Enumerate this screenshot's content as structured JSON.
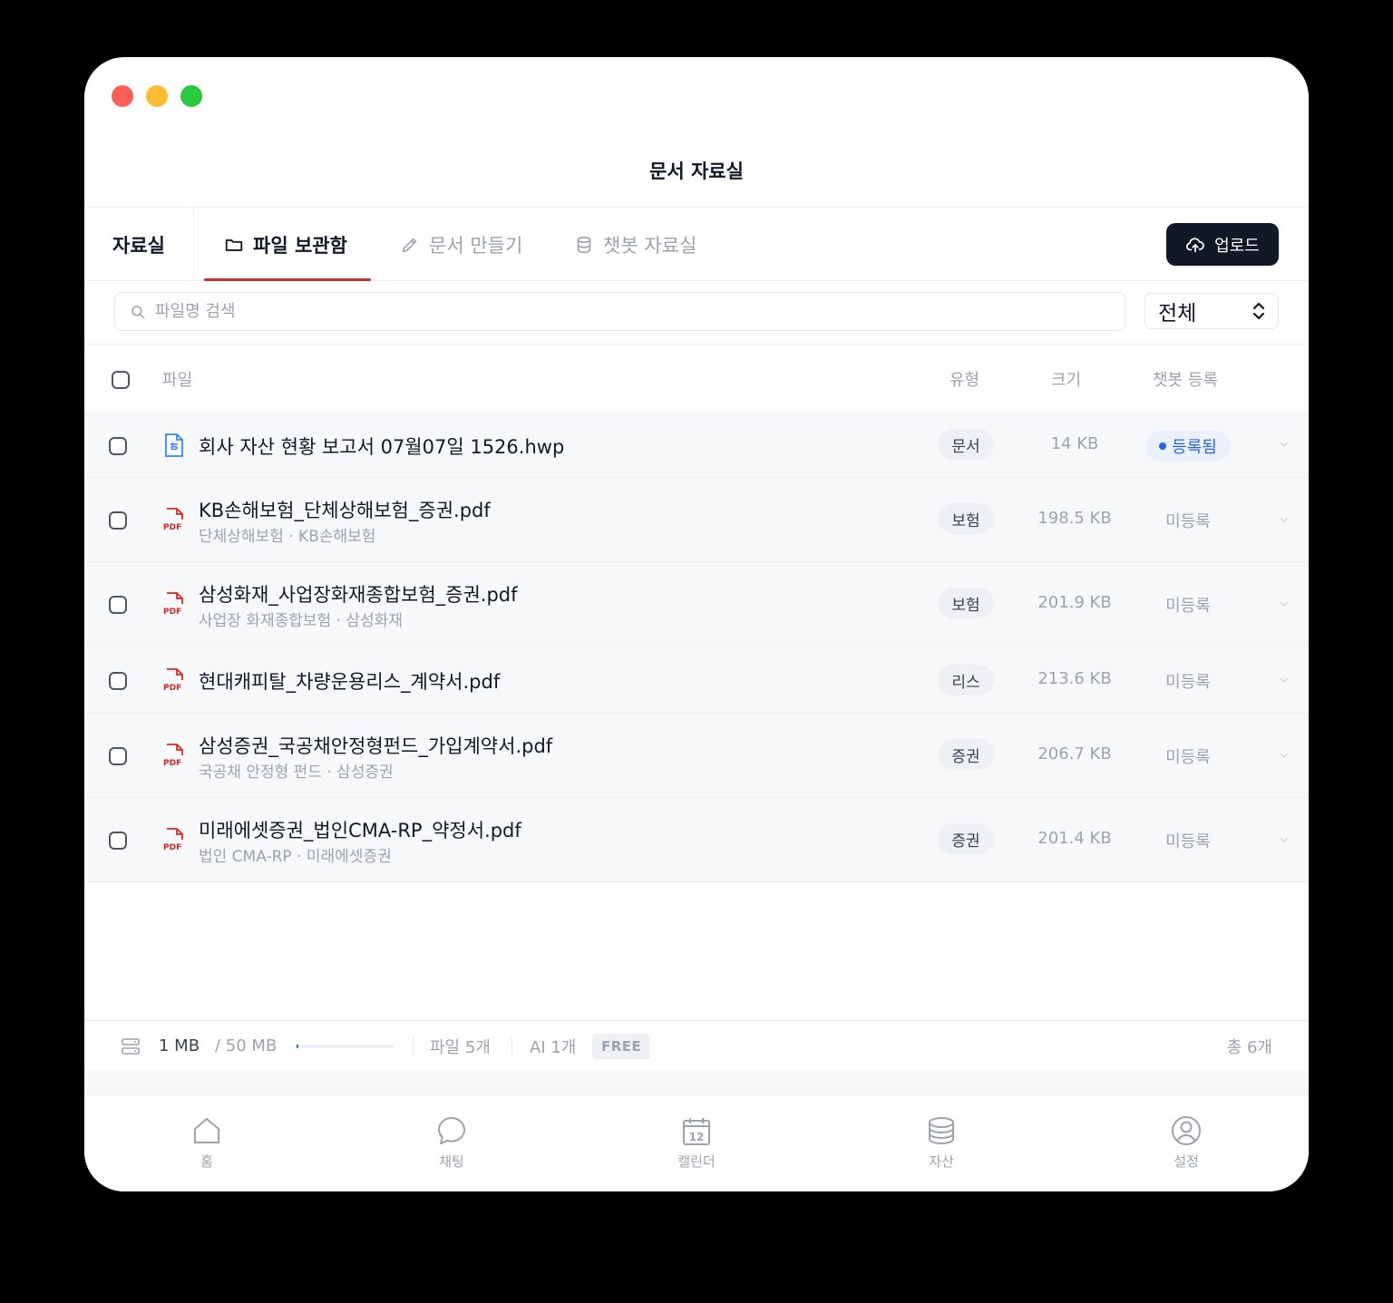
{
  "window": {
    "title": "문서 자료실"
  },
  "tabs": {
    "section_label": "자료실",
    "items": [
      {
        "label": "파일 보관함",
        "icon": "folder-icon",
        "active": true
      },
      {
        "label": "문서 만들기",
        "icon": "pencil-icon",
        "active": false
      },
      {
        "label": "챗봇 자료실",
        "icon": "database-icon",
        "active": false
      }
    ],
    "upload_label": "업로드"
  },
  "search": {
    "placeholder": "파일명 검색",
    "filter_value": "전체"
  },
  "table": {
    "headers": {
      "file": "파일",
      "type": "유형",
      "size": "크기",
      "chatbot": "챗봇 등록"
    },
    "rows": [
      {
        "name": "회사 자산 현황 보고서 07월07일 1526.hwp",
        "sub": "",
        "icon": "hwp-doc-icon",
        "type": "문서",
        "size": "14 KB",
        "status": "등록됨",
        "registered": true
      },
      {
        "name": "KB손해보험_단체상해보험_증권.pdf",
        "sub": "단체상해보험 · KB손해보험",
        "icon": "pdf-icon",
        "type": "보험",
        "size": "198.5 KB",
        "status": "미등록",
        "registered": false
      },
      {
        "name": "삼성화재_사업장화재종합보험_증권.pdf",
        "sub": "사업장 화재종합보험 · 삼성화재",
        "icon": "pdf-icon",
        "type": "보험",
        "size": "201.9 KB",
        "status": "미등록",
        "registered": false
      },
      {
        "name": "현대캐피탈_차량운용리스_계약서.pdf",
        "sub": "",
        "icon": "pdf-icon",
        "type": "리스",
        "size": "213.6 KB",
        "status": "미등록",
        "registered": false
      },
      {
        "name": "삼성증권_국공채안정형펀드_가입계약서.pdf",
        "sub": "국공채 안정형 펀드 · 삼성증권",
        "icon": "pdf-icon",
        "type": "증권",
        "size": "206.7 KB",
        "status": "미등록",
        "registered": false
      },
      {
        "name": "미래에셋증권_법인CMA-RP_약정서.pdf",
        "sub": "법인 CMA-RP · 미래에셋증권",
        "icon": "pdf-icon",
        "type": "증권",
        "size": "201.4 KB",
        "status": "미등록",
        "registered": false
      }
    ]
  },
  "status_bar": {
    "used": "1 MB",
    "total": "/ 50 MB",
    "usage_fraction": 0.02,
    "files": "파일 5개",
    "ai": "AI 1개",
    "plan": "FREE",
    "count": "총 6개"
  },
  "bottom_nav": [
    {
      "label": "홈",
      "icon": "home-icon"
    },
    {
      "label": "채팅",
      "icon": "chat-icon"
    },
    {
      "label": "캘린더",
      "icon": "calendar-icon",
      "icon_text": "12"
    },
    {
      "label": "자산",
      "icon": "coins-icon"
    },
    {
      "label": "설정",
      "icon": "user-circle-icon"
    }
  ],
  "colors": {
    "accent_tab": "#c53030",
    "primary_button": "#111827",
    "registered_blue": "#2563eb",
    "pdf_red": "#dc2626",
    "hwp_blue": "#3b82f6"
  }
}
